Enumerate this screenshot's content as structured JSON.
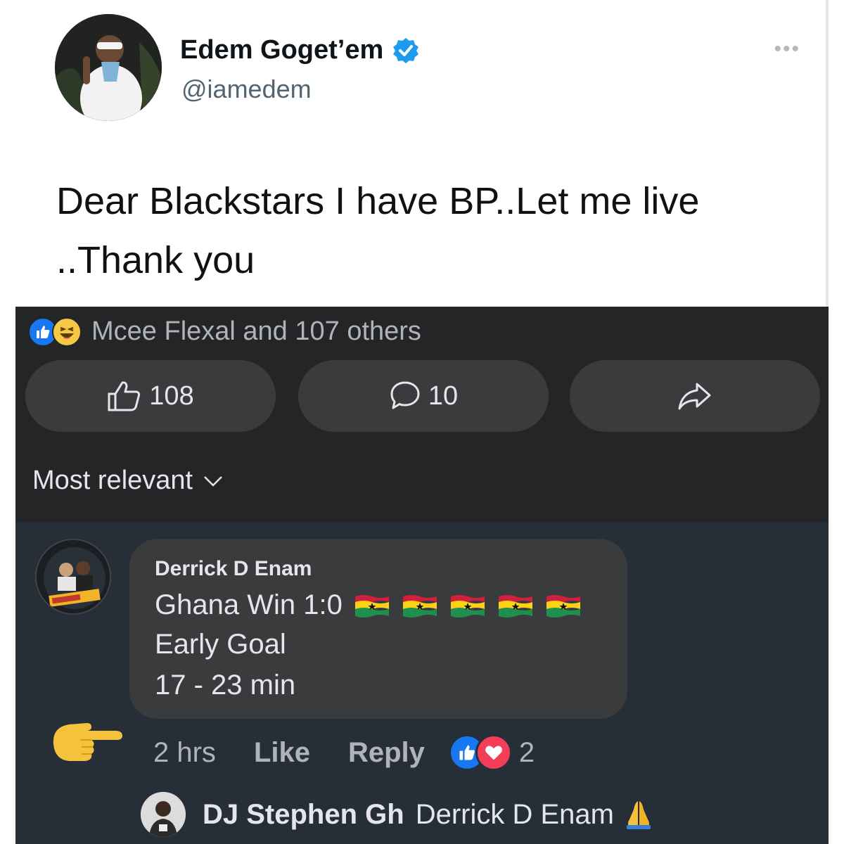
{
  "tweet": {
    "author_name": "Edem Goget’em",
    "handle": "@iamedem",
    "more_icon": "ellipsis-icon",
    "text": "Dear Blackstars   I have BP..Let me live ..Thank you",
    "verified_color": "#1d9bf0"
  },
  "post": {
    "reactions_text": "Mcee Flexal and 107 others",
    "like_count": "108",
    "comment_count": "10",
    "sort_label": "Most relevant",
    "icons": [
      "like-reaction-icon",
      "haha-reaction-icon",
      "thumbs-up-icon",
      "comment-icon",
      "share-icon",
      "chevron-down-icon"
    ]
  },
  "comment": {
    "author": "Derrick D Enam",
    "line1": "Ghana Win 1:0",
    "flag_count": 5,
    "line2": "Early Goal",
    "line3": "17 - 23 min",
    "time": "2 hrs",
    "like_label": "Like",
    "reply_label": "Reply",
    "reaction_count": "2"
  },
  "reply": {
    "author": "DJ Stephen Gh",
    "text": "Derrick D Enam"
  },
  "colors": {
    "fb_dark": "#242526",
    "comments_bg": "#262e38",
    "button_bg": "#3a3b3c",
    "fb_blue": "#1877f2",
    "love_red": "#f33e58"
  }
}
